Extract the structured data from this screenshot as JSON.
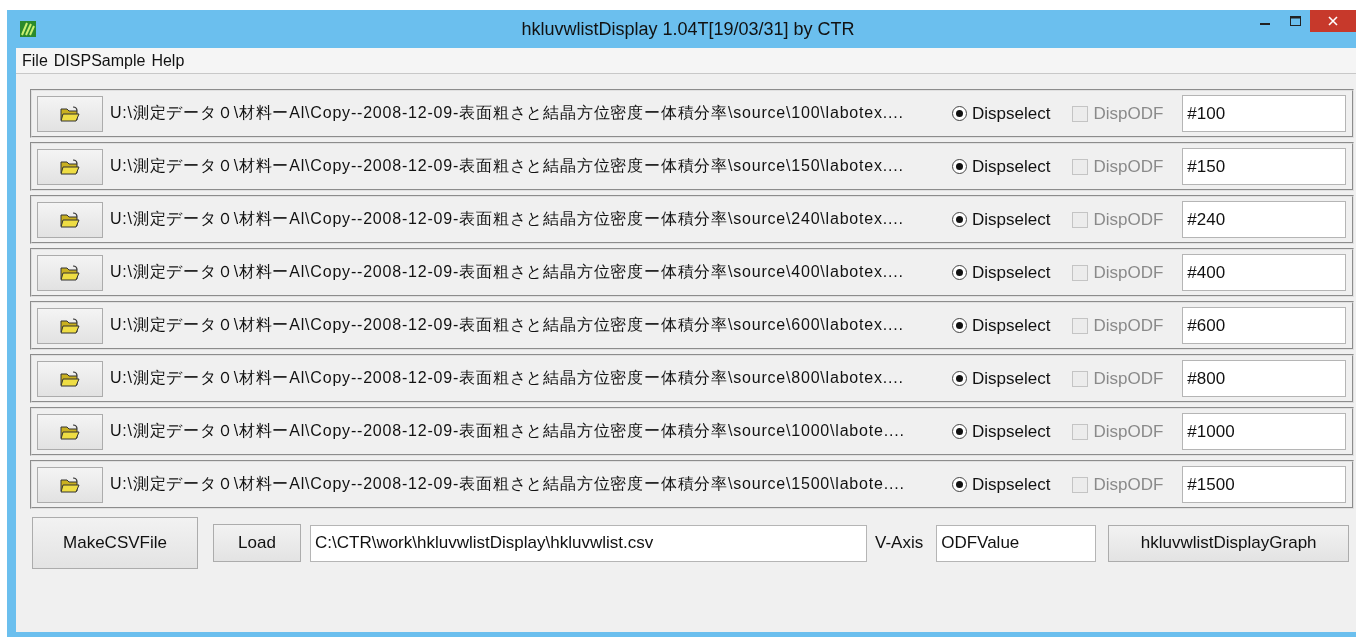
{
  "window": {
    "title": "hkluvwlistDisplay 1.04T[19/03/31] by CTR"
  },
  "menu": [
    "File",
    "DISPSample",
    "Help"
  ],
  "rows": [
    {
      "path": "U:\\測定データ０\\材料ーAl\\Copy--2008-12-09-表面粗さと結晶方位密度ー体積分率\\source\\100\\labotex....",
      "dispselect": {
        "label": "Dispselect",
        "selected": true
      },
      "dispodf": {
        "label": "DispODF",
        "checked": false,
        "disabled": true
      },
      "name": "#100"
    },
    {
      "path": "U:\\測定データ０\\材料ーAl\\Copy--2008-12-09-表面粗さと結晶方位密度ー体積分率\\source\\150\\labotex....",
      "dispselect": {
        "label": "Dispselect",
        "selected": true
      },
      "dispodf": {
        "label": "DispODF",
        "checked": false,
        "disabled": true
      },
      "name": "#150"
    },
    {
      "path": "U:\\測定データ０\\材料ーAl\\Copy--2008-12-09-表面粗さと結晶方位密度ー体積分率\\source\\240\\labotex....",
      "dispselect": {
        "label": "Dispselect",
        "selected": true
      },
      "dispodf": {
        "label": "DispODF",
        "checked": false,
        "disabled": true
      },
      "name": "#240"
    },
    {
      "path": "U:\\測定データ０\\材料ーAl\\Copy--2008-12-09-表面粗さと結晶方位密度ー体積分率\\source\\400\\labotex....",
      "dispselect": {
        "label": "Dispselect",
        "selected": true
      },
      "dispodf": {
        "label": "DispODF",
        "checked": false,
        "disabled": true
      },
      "name": "#400"
    },
    {
      "path": "U:\\測定データ０\\材料ーAl\\Copy--2008-12-09-表面粗さと結晶方位密度ー体積分率\\source\\600\\labotex....",
      "dispselect": {
        "label": "Dispselect",
        "selected": true
      },
      "dispodf": {
        "label": "DispODF",
        "checked": false,
        "disabled": true
      },
      "name": "#600"
    },
    {
      "path": "U:\\測定データ０\\材料ーAl\\Copy--2008-12-09-表面粗さと結晶方位密度ー体積分率\\source\\800\\labotex....",
      "dispselect": {
        "label": "Dispselect",
        "selected": true
      },
      "dispodf": {
        "label": "DispODF",
        "checked": false,
        "disabled": true
      },
      "name": "#800"
    },
    {
      "path": "U:\\測定データ０\\材料ーAl\\Copy--2008-12-09-表面粗さと結晶方位密度ー体積分率\\source\\1000\\labote....",
      "dispselect": {
        "label": "Dispselect",
        "selected": true
      },
      "dispodf": {
        "label": "DispODF",
        "checked": false,
        "disabled": true
      },
      "name": "#1000"
    },
    {
      "path": "U:\\測定データ０\\材料ーAl\\Copy--2008-12-09-表面粗さと結晶方位密度ー体積分率\\source\\1500\\labote....",
      "dispselect": {
        "label": "Dispselect",
        "selected": true
      },
      "dispodf": {
        "label": "DispODF",
        "checked": false,
        "disabled": true
      },
      "name": "#1500"
    }
  ],
  "bottom": {
    "make_csv_button": "MakeCSVFile",
    "load_button": "Load",
    "csv_path": "C:\\CTR\\work\\hkluvwlistDisplay\\hkluvwlist.csv",
    "vaxis_label": "V-Axis",
    "vaxis_value": "ODFValue",
    "graph_button": "hkluvwlistDisplayGraph"
  }
}
